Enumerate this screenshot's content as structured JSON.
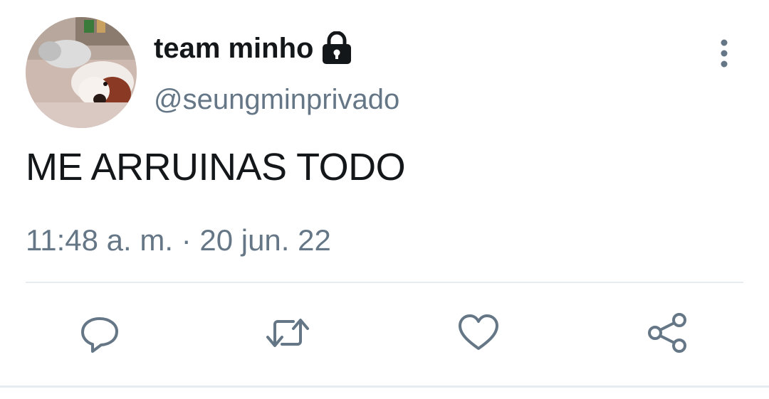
{
  "tweet": {
    "display_name": "team minho",
    "handle": "@seungminprivado",
    "text": "ME ARRUINAS TODO",
    "time": "11:48 a. m.",
    "separator": "·",
    "date": "20 jun. 22",
    "account_locked": true
  },
  "icons": {
    "lock": "lock-icon",
    "more": "more-vertical-icon",
    "reply": "reply-icon",
    "retweet": "retweet-icon",
    "like": "heart-icon",
    "share": "share-icon"
  },
  "colors": {
    "text_primary": "#14171a",
    "text_secondary": "#657786",
    "divider": "#e6ecf0",
    "background": "#ffffff"
  }
}
